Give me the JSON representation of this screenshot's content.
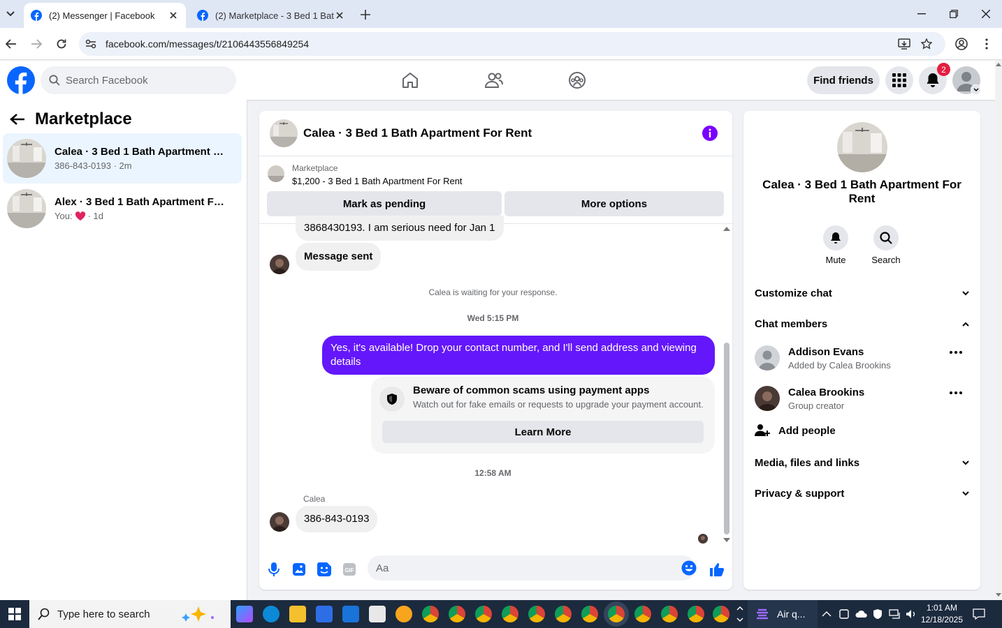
{
  "browser": {
    "tabs": [
      {
        "title": "(2) Messenger | Facebook",
        "active": true
      },
      {
        "title": "(2) Marketplace - 3 Bed 1 Bath Ap",
        "active": false
      }
    ],
    "url": "facebook.com/messages/t/2106443556849254"
  },
  "header": {
    "search_placeholder": "Search Facebook",
    "find_friends": "Find friends",
    "notification_count": "2"
  },
  "sidebar": {
    "title": "Marketplace",
    "conversations": [
      {
        "title": "Calea · 3 Bed 1 Bath Apartment For Rent",
        "subtitle": "386-843-0193 · 2m"
      },
      {
        "title": "Alex · 3 Bed 1 Bath Apartment For Rent",
        "subtitle_prefix": "You:",
        "subtitle_suffix": "· 1d"
      }
    ]
  },
  "chat": {
    "title": "Calea · 3 Bed 1 Bath Apartment For Rent",
    "listing": {
      "source": "Marketplace",
      "title": "$1,200 - 3 Bed 1 Bath Apartment For Rent",
      "mark_pending": "Mark as pending",
      "more_options": "More options"
    },
    "messages": {
      "partial": "3868430193. I am serious need for Jan 1",
      "msg_sent": "Message sent",
      "waiting": "Calea is waiting for your response.",
      "time1": "Wed 5:15 PM",
      "outgoing": "Yes, it's available! Drop your contact number, and I'll send address and viewing details",
      "scam_title": "Beware of common scams using payment apps",
      "scam_body": "Watch out for fake emails or requests to upgrade your payment account.",
      "learn_more": "Learn More",
      "time2": "12:58 AM",
      "sender": "Calea",
      "phone": "386-843-0193"
    },
    "composer_placeholder": "Aa"
  },
  "info_panel": {
    "name": "Calea · 3 Bed 1 Bath Apartment For Rent",
    "mute": "Mute",
    "search": "Search",
    "customize": "Customize chat",
    "members_header": "Chat members",
    "members": [
      {
        "name": "Addison Evans",
        "sub": "Added by Calea Brookins"
      },
      {
        "name": "Calea Brookins",
        "sub": "Group creator"
      }
    ],
    "add_people": "Add people",
    "media": "Media, files and links",
    "privacy": "Privacy & support"
  },
  "taskbar": {
    "search_placeholder": "Type here to search",
    "weather": "Air q...",
    "time": "1:01 AM",
    "date": "12/18/2025"
  },
  "colors": {
    "brand": "#0866ff",
    "accent": "#6417fa",
    "badge": "#e41e3f"
  }
}
